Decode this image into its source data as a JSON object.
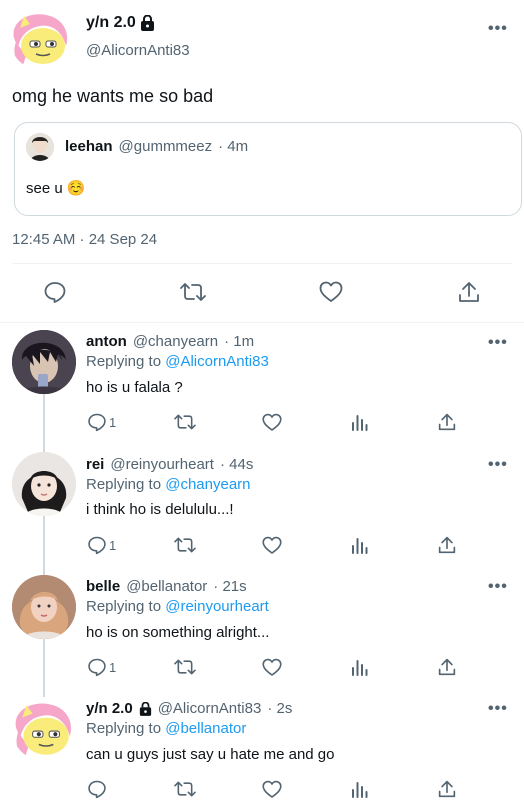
{
  "main_tweet": {
    "display_name": "y/n 2.0",
    "handle": "@AlicornAnti83",
    "text": "omg he wants me so bad",
    "timestamp": "12:45 AM · 24 Sep 24",
    "quote": {
      "display_name": "leehan",
      "handle": "@gummmeez",
      "time": "· 4m",
      "text": "see u ☺️"
    }
  },
  "replies": [
    {
      "display_name": "anton",
      "handle": "@chanyearn",
      "time": "· 1m",
      "replying_label": "Replying to",
      "replying_to": "@AlicornAnti83",
      "text": "ho is u falala ?",
      "reply_count": "1"
    },
    {
      "display_name": "rei",
      "handle": "@reinyourheart",
      "time": "· 44s",
      "replying_label": "Replying to",
      "replying_to": "@chanyearn",
      "text": "i think ho is delululu...!",
      "reply_count": "1"
    },
    {
      "display_name": "belle",
      "handle": "@bellanator",
      "time": "· 21s",
      "replying_label": "Replying to",
      "replying_to": "@reinyourheart",
      "text": "ho is on something alright...",
      "reply_count": "1"
    },
    {
      "display_name": "y/n 2.0",
      "handle": "@AlicornAnti83",
      "time": "· 2s",
      "replying_label": "Replying to",
      "replying_to": "@bellanator",
      "text": "can u guys just say u hate me and go",
      "reply_count": ""
    }
  ],
  "icons": [
    "lock-icon",
    "reply-icon",
    "retweet-icon",
    "like-icon",
    "views-icon",
    "share-icon",
    "more-icon"
  ],
  "colors": {
    "accent": "#1d9bf0",
    "muted": "#536471",
    "text": "#0f1419",
    "border": "#cfd9de"
  }
}
